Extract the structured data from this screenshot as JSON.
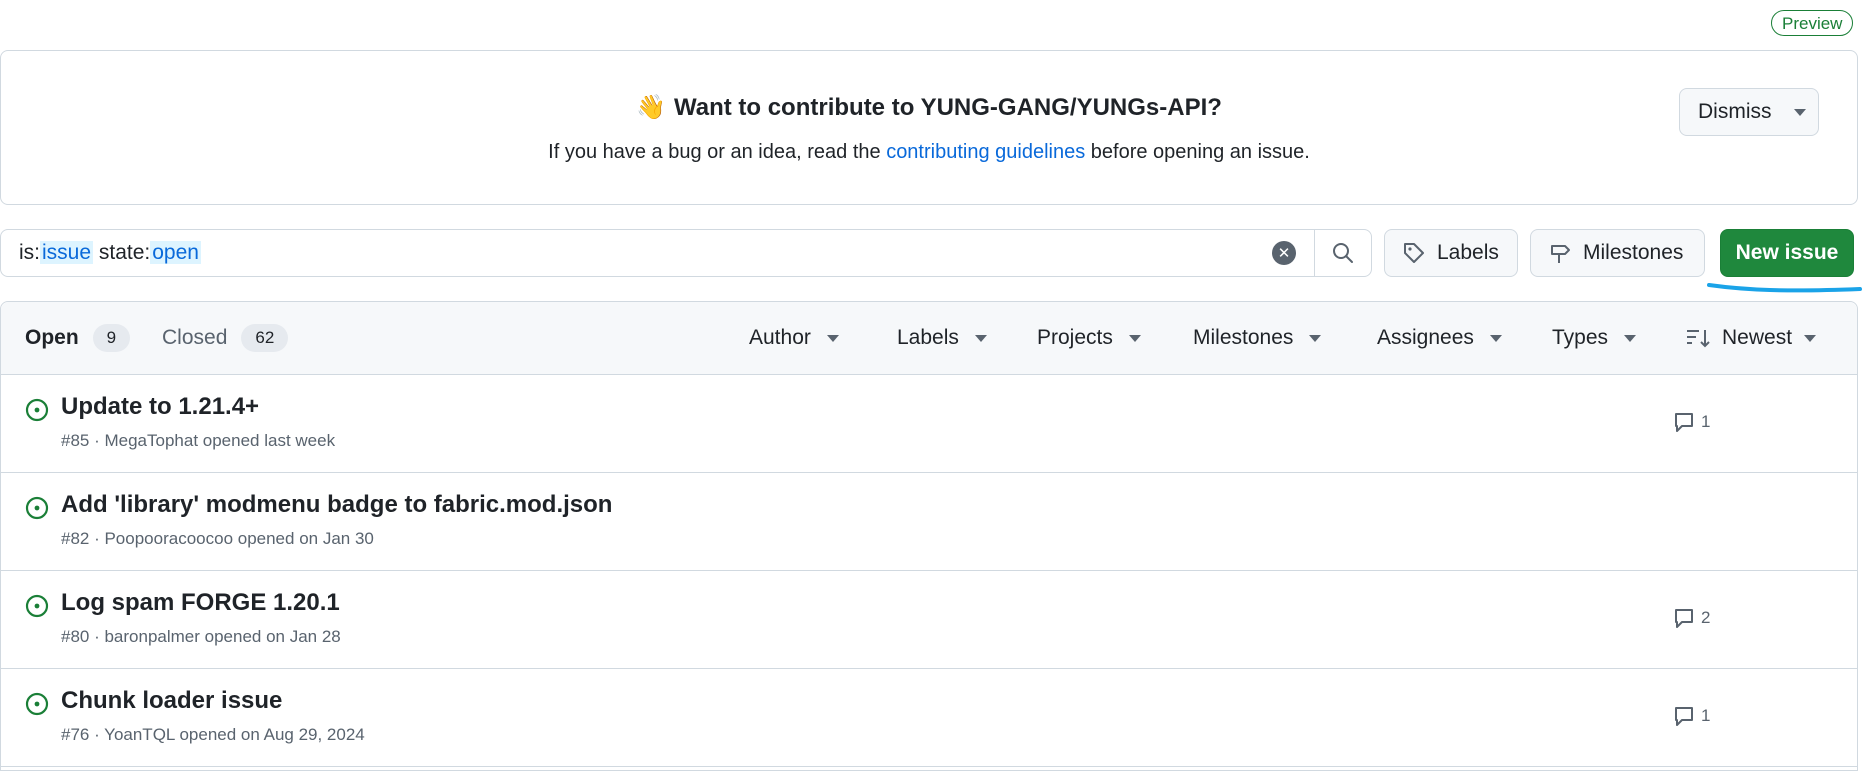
{
  "preview_label": "Preview",
  "banner": {
    "emoji": "👋",
    "title": "Want to contribute to YUNG-GANG/YUNGs-API?",
    "sub_before": "If you have a bug or an idea, read the ",
    "sub_link": "contributing guidelines",
    "sub_after": " before opening an issue.",
    "dismiss_label": "Dismiss"
  },
  "search": {
    "prefix1": "is:",
    "token1": "issue",
    "prefix2": " state:",
    "token2": "open"
  },
  "buttons": {
    "labels": "Labels",
    "milestones": "Milestones",
    "new_issue": "New issue"
  },
  "colors": {
    "accent_green": "#1f883d",
    "link_blue": "#0969da",
    "annotation_blue": "#1aa3e8"
  },
  "tabs": {
    "open_label": "Open",
    "open_count": "9",
    "closed_label": "Closed",
    "closed_count": "62"
  },
  "filters": [
    "Author",
    "Labels",
    "Projects",
    "Milestones",
    "Assignees",
    "Types"
  ],
  "sort_label": "Newest",
  "issues": [
    {
      "title": "Update to 1.21.4+",
      "meta": "#85 · MegaTophat opened last week",
      "comments": "1"
    },
    {
      "title": "Add 'library' modmenu badge to fabric.mod.json",
      "meta": "#82 · Poopooracoocoo opened on Jan 30",
      "comments": ""
    },
    {
      "title": "Log spam FORGE 1.20.1",
      "meta": "#80 · baronpalmer opened on Jan 28",
      "comments": "2"
    },
    {
      "title": "Chunk loader issue",
      "meta": "#76 · YoanTQL opened on Aug 29, 2024",
      "comments": "1"
    }
  ]
}
